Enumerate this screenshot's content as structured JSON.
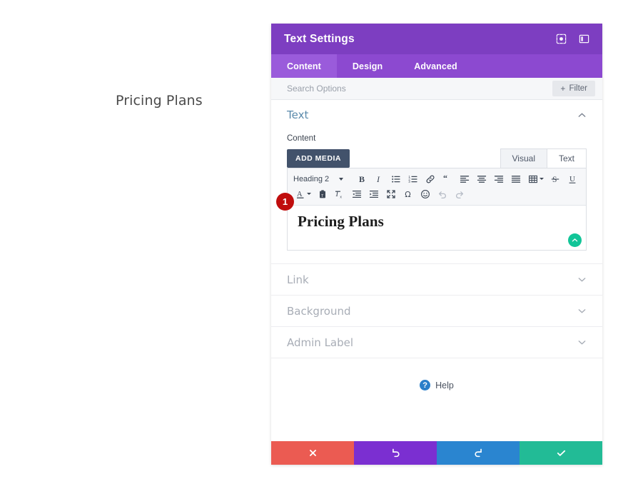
{
  "canvas": {
    "heading": "Pricing Plans"
  },
  "modal": {
    "title": "Text Settings",
    "header_icons": [
      {
        "name": "focus-target-icon",
        "label": "Focus"
      },
      {
        "name": "panel-layout-icon",
        "label": "Layout"
      }
    ],
    "tabs": [
      {
        "label": "Content",
        "active": true
      },
      {
        "label": "Design",
        "active": false
      },
      {
        "label": "Advanced",
        "active": false
      }
    ],
    "search": {
      "placeholder": "Search Options",
      "value": ""
    },
    "filter_button": {
      "plus": "+",
      "label": "Filter"
    },
    "text_section": {
      "title": "Text",
      "field_label": "Content",
      "add_media_label": "ADD MEDIA",
      "view_tabs": [
        {
          "label": "Visual",
          "active": true
        },
        {
          "label": "Text",
          "active": false
        }
      ],
      "toolbar": {
        "format_select": "Heading 2",
        "row1": [
          "bold-icon",
          "italic-icon",
          "bulleted-list-icon",
          "numbered-list-icon",
          "link-icon",
          "blockquote-icon",
          "align-left-icon",
          "align-center-icon",
          "align-right-icon",
          "align-justify-icon",
          "table-icon",
          "strikethrough-icon",
          "underline-icon"
        ],
        "row2": [
          "text-color-icon",
          "paste-as-text-icon",
          "clear-formatting-icon",
          "outdent-icon",
          "indent-icon",
          "fullscreen-icon",
          "special-character-icon",
          "emoji-icon",
          "undo-icon",
          "redo-icon"
        ]
      },
      "editor_content": "Pricing Plans",
      "step_badge": "1"
    },
    "sections": [
      {
        "title": "Link"
      },
      {
        "title": "Background"
      },
      {
        "title": "Admin Label"
      }
    ],
    "help": {
      "glyph": "?",
      "label": "Help"
    },
    "footer_buttons": [
      {
        "name": "cancel-button",
        "icon": "close-icon",
        "color": "#eb5b52"
      },
      {
        "name": "undo-button",
        "icon": "undo-icon",
        "color": "#7b2fd1"
      },
      {
        "name": "redo-button",
        "icon": "redo-icon",
        "color": "#2a85d0"
      },
      {
        "name": "save-button",
        "icon": "check-icon",
        "color": "#22bb96"
      }
    ]
  },
  "colors": {
    "header_purple": "#7d3ec1",
    "tabs_purple": "#8c49d0",
    "active_tab_purple": "#9a5bdb",
    "badge_red": "#c00d0d",
    "resize_teal": "#12c598"
  }
}
